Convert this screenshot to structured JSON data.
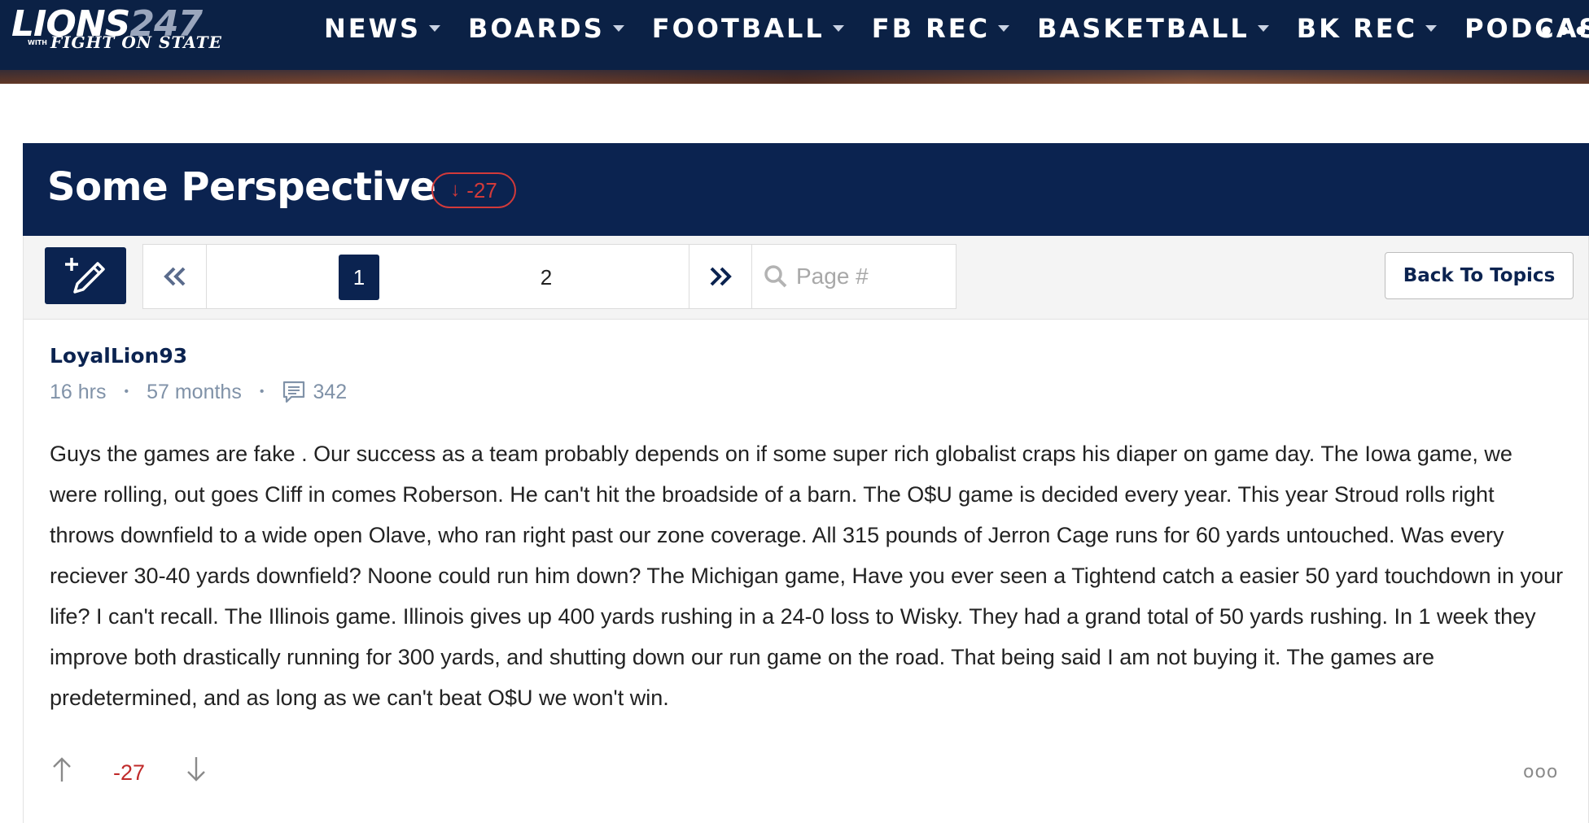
{
  "site": {
    "logo_main": "LIONS",
    "logo_247": "247",
    "logo_with": "WITH",
    "logo_sub": "FIGHT ON STATE"
  },
  "nav": {
    "items": [
      {
        "label": "NEWS"
      },
      {
        "label": "BOARDS"
      },
      {
        "label": "FOOTBALL"
      },
      {
        "label": "FB REC"
      },
      {
        "label": "BASKETBALL"
      },
      {
        "label": "BK REC"
      },
      {
        "label": "PODCASTS"
      }
    ],
    "more": "•••"
  },
  "thread": {
    "title": "Some Perspective",
    "score": "-27"
  },
  "toolbar": {
    "first_page": "«",
    "pages": [
      "1",
      "2"
    ],
    "current_page": "1",
    "last_page": "»",
    "page_placeholder": "Page #",
    "back_label": "Back To Topics"
  },
  "post": {
    "author": "LoyalLion93",
    "time": "16 hrs",
    "tenure": "57 months",
    "post_count": "342",
    "body": "Guys the games are fake . Our success as a team probably depends on if some super rich globalist craps his diaper on game day. The Iowa game, we were rolling, out goes Cliff in comes Roberson. He can't hit the broadside of a barn. The O$U game is decided every year. This year Stroud rolls right throws downfield to a wide open Olave, who ran right past our zone coverage. All 315 pounds of Jerron Cage runs for 60 yards untouched. Was every reciever 30-40 yards downfield? Noone could run him down? The Michigan game, Have you ever seen a Tightend catch a easier 50 yard touchdown in your life? I can't recall. The Illinois game. Illinois gives up 400 yards rushing in a 24-0 loss to Wisky. They had a grand total of 50 yards rushing. In 1 week they improve both drastically running for 300 yards, and shutting down our run game on the road. That being said I am not buying it. The games are predetermined, and as long as we can't beat O$U we won't win.",
    "score": "-27",
    "more": "ooo"
  },
  "colors": {
    "navy": "#0b2350",
    "downvote_red": "#c02a2a",
    "meta_gray": "#8092a8"
  }
}
